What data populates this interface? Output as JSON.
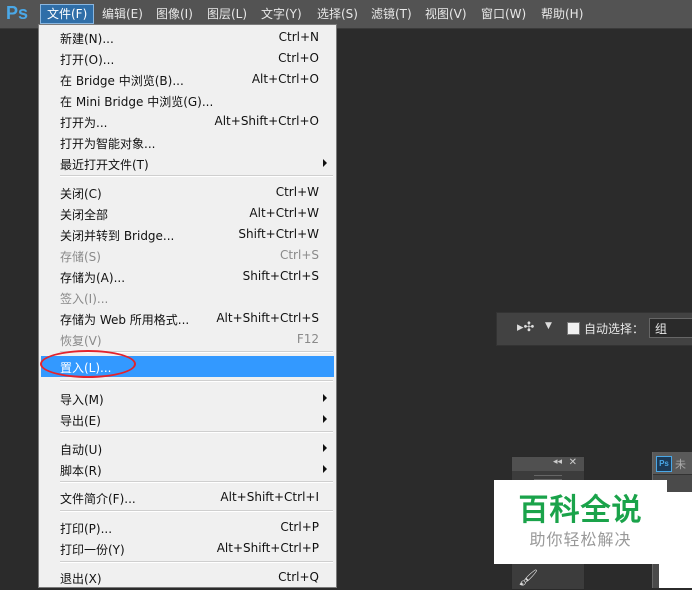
{
  "app": {
    "logo": "Ps"
  },
  "menubar": [
    {
      "id": "file",
      "label": "文件(F)"
    },
    {
      "id": "edit",
      "label": "编辑(E)"
    },
    {
      "id": "image",
      "label": "图像(I)"
    },
    {
      "id": "layer",
      "label": "图层(L)"
    },
    {
      "id": "type",
      "label": "文字(Y)"
    },
    {
      "id": "select",
      "label": "选择(S)"
    },
    {
      "id": "filter",
      "label": "滤镜(T)"
    },
    {
      "id": "view",
      "label": "视图(V)"
    },
    {
      "id": "window",
      "label": "窗口(W)"
    },
    {
      "id": "help",
      "label": "帮助(H)"
    }
  ],
  "file_menu": {
    "new": {
      "label": "新建(N)...",
      "shortcut": "Ctrl+N"
    },
    "open": {
      "label": "打开(O)...",
      "shortcut": "Ctrl+O"
    },
    "browse_bridge": {
      "label": "在 Bridge 中浏览(B)...",
      "shortcut": "Alt+Ctrl+O"
    },
    "browse_mini_bridge": {
      "label": "在 Mini Bridge 中浏览(G)..."
    },
    "open_as": {
      "label": "打开为...",
      "shortcut": "Alt+Shift+Ctrl+O"
    },
    "open_smart_object": {
      "label": "打开为智能对象..."
    },
    "open_recent": {
      "label": "最近打开文件(T)"
    },
    "close": {
      "label": "关闭(C)",
      "shortcut": "Ctrl+W"
    },
    "close_all": {
      "label": "关闭全部",
      "shortcut": "Alt+Ctrl+W"
    },
    "close_go_bridge": {
      "label": "关闭并转到 Bridge...",
      "shortcut": "Shift+Ctrl+W"
    },
    "save": {
      "label": "存储(S)",
      "shortcut": "Ctrl+S"
    },
    "save_as": {
      "label": "存储为(A)...",
      "shortcut": "Shift+Ctrl+S"
    },
    "check_in": {
      "label": "签入(I)..."
    },
    "save_for_web": {
      "label": "存储为 Web 所用格式...",
      "shortcut": "Alt+Shift+Ctrl+S"
    },
    "revert": {
      "label": "恢复(V)",
      "shortcut": "F12"
    },
    "place": {
      "label": "置入(L)..."
    },
    "import": {
      "label": "导入(M)"
    },
    "export": {
      "label": "导出(E)"
    },
    "automate": {
      "label": "自动(U)"
    },
    "scripts": {
      "label": "脚本(R)"
    },
    "file_info": {
      "label": "文件简介(F)...",
      "shortcut": "Alt+Shift+Ctrl+I"
    },
    "print": {
      "label": "打印(P)...",
      "shortcut": "Ctrl+P"
    },
    "print_one": {
      "label": "打印一份(Y)",
      "shortcut": "Alt+Shift+Ctrl+P"
    },
    "exit": {
      "label": "退出(X)",
      "shortcut": "Ctrl+Q"
    }
  },
  "options_bar": {
    "auto_select_label": "自动选择：",
    "group_value": "组"
  },
  "doc_window": {
    "title_fragment": "未"
  },
  "watermark": {
    "main": "百科全说",
    "sub": "助你轻松解决"
  },
  "colors": {
    "menubar_bg": "#535353",
    "workspace_bg": "#2b2b2b",
    "highlight": "#3399ff",
    "circle": "#e2232d",
    "watermark_green": "#1aa34a"
  }
}
